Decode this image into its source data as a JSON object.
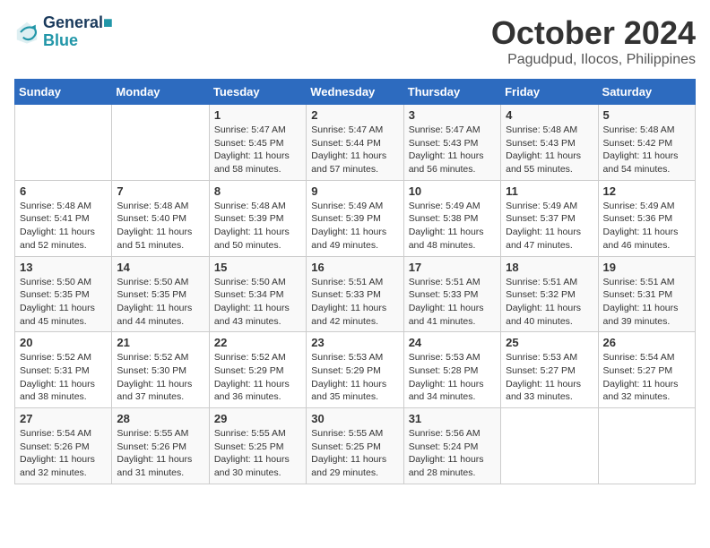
{
  "logo": {
    "line1": "General",
    "line2": "Blue"
  },
  "title": "October 2024",
  "subtitle": "Pagudpud, Ilocos, Philippines",
  "weekdays": [
    "Sunday",
    "Monday",
    "Tuesday",
    "Wednesday",
    "Thursday",
    "Friday",
    "Saturday"
  ],
  "weeks": [
    [
      {
        "day": "",
        "sunrise": "",
        "sunset": "",
        "daylight": ""
      },
      {
        "day": "",
        "sunrise": "",
        "sunset": "",
        "daylight": ""
      },
      {
        "day": "1",
        "sunrise": "Sunrise: 5:47 AM",
        "sunset": "Sunset: 5:45 PM",
        "daylight": "Daylight: 11 hours and 58 minutes."
      },
      {
        "day": "2",
        "sunrise": "Sunrise: 5:47 AM",
        "sunset": "Sunset: 5:44 PM",
        "daylight": "Daylight: 11 hours and 57 minutes."
      },
      {
        "day": "3",
        "sunrise": "Sunrise: 5:47 AM",
        "sunset": "Sunset: 5:43 PM",
        "daylight": "Daylight: 11 hours and 56 minutes."
      },
      {
        "day": "4",
        "sunrise": "Sunrise: 5:48 AM",
        "sunset": "Sunset: 5:43 PM",
        "daylight": "Daylight: 11 hours and 55 minutes."
      },
      {
        "day": "5",
        "sunrise": "Sunrise: 5:48 AM",
        "sunset": "Sunset: 5:42 PM",
        "daylight": "Daylight: 11 hours and 54 minutes."
      }
    ],
    [
      {
        "day": "6",
        "sunrise": "Sunrise: 5:48 AM",
        "sunset": "Sunset: 5:41 PM",
        "daylight": "Daylight: 11 hours and 52 minutes."
      },
      {
        "day": "7",
        "sunrise": "Sunrise: 5:48 AM",
        "sunset": "Sunset: 5:40 PM",
        "daylight": "Daylight: 11 hours and 51 minutes."
      },
      {
        "day": "8",
        "sunrise": "Sunrise: 5:48 AM",
        "sunset": "Sunset: 5:39 PM",
        "daylight": "Daylight: 11 hours and 50 minutes."
      },
      {
        "day": "9",
        "sunrise": "Sunrise: 5:49 AM",
        "sunset": "Sunset: 5:39 PM",
        "daylight": "Daylight: 11 hours and 49 minutes."
      },
      {
        "day": "10",
        "sunrise": "Sunrise: 5:49 AM",
        "sunset": "Sunset: 5:38 PM",
        "daylight": "Daylight: 11 hours and 48 minutes."
      },
      {
        "day": "11",
        "sunrise": "Sunrise: 5:49 AM",
        "sunset": "Sunset: 5:37 PM",
        "daylight": "Daylight: 11 hours and 47 minutes."
      },
      {
        "day": "12",
        "sunrise": "Sunrise: 5:49 AM",
        "sunset": "Sunset: 5:36 PM",
        "daylight": "Daylight: 11 hours and 46 minutes."
      }
    ],
    [
      {
        "day": "13",
        "sunrise": "Sunrise: 5:50 AM",
        "sunset": "Sunset: 5:35 PM",
        "daylight": "Daylight: 11 hours and 45 minutes."
      },
      {
        "day": "14",
        "sunrise": "Sunrise: 5:50 AM",
        "sunset": "Sunset: 5:35 PM",
        "daylight": "Daylight: 11 hours and 44 minutes."
      },
      {
        "day": "15",
        "sunrise": "Sunrise: 5:50 AM",
        "sunset": "Sunset: 5:34 PM",
        "daylight": "Daylight: 11 hours and 43 minutes."
      },
      {
        "day": "16",
        "sunrise": "Sunrise: 5:51 AM",
        "sunset": "Sunset: 5:33 PM",
        "daylight": "Daylight: 11 hours and 42 minutes."
      },
      {
        "day": "17",
        "sunrise": "Sunrise: 5:51 AM",
        "sunset": "Sunset: 5:33 PM",
        "daylight": "Daylight: 11 hours and 41 minutes."
      },
      {
        "day": "18",
        "sunrise": "Sunrise: 5:51 AM",
        "sunset": "Sunset: 5:32 PM",
        "daylight": "Daylight: 11 hours and 40 minutes."
      },
      {
        "day": "19",
        "sunrise": "Sunrise: 5:51 AM",
        "sunset": "Sunset: 5:31 PM",
        "daylight": "Daylight: 11 hours and 39 minutes."
      }
    ],
    [
      {
        "day": "20",
        "sunrise": "Sunrise: 5:52 AM",
        "sunset": "Sunset: 5:31 PM",
        "daylight": "Daylight: 11 hours and 38 minutes."
      },
      {
        "day": "21",
        "sunrise": "Sunrise: 5:52 AM",
        "sunset": "Sunset: 5:30 PM",
        "daylight": "Daylight: 11 hours and 37 minutes."
      },
      {
        "day": "22",
        "sunrise": "Sunrise: 5:52 AM",
        "sunset": "Sunset: 5:29 PM",
        "daylight": "Daylight: 11 hours and 36 minutes."
      },
      {
        "day": "23",
        "sunrise": "Sunrise: 5:53 AM",
        "sunset": "Sunset: 5:29 PM",
        "daylight": "Daylight: 11 hours and 35 minutes."
      },
      {
        "day": "24",
        "sunrise": "Sunrise: 5:53 AM",
        "sunset": "Sunset: 5:28 PM",
        "daylight": "Daylight: 11 hours and 34 minutes."
      },
      {
        "day": "25",
        "sunrise": "Sunrise: 5:53 AM",
        "sunset": "Sunset: 5:27 PM",
        "daylight": "Daylight: 11 hours and 33 minutes."
      },
      {
        "day": "26",
        "sunrise": "Sunrise: 5:54 AM",
        "sunset": "Sunset: 5:27 PM",
        "daylight": "Daylight: 11 hours and 32 minutes."
      }
    ],
    [
      {
        "day": "27",
        "sunrise": "Sunrise: 5:54 AM",
        "sunset": "Sunset: 5:26 PM",
        "daylight": "Daylight: 11 hours and 32 minutes."
      },
      {
        "day": "28",
        "sunrise": "Sunrise: 5:55 AM",
        "sunset": "Sunset: 5:26 PM",
        "daylight": "Daylight: 11 hours and 31 minutes."
      },
      {
        "day": "29",
        "sunrise": "Sunrise: 5:55 AM",
        "sunset": "Sunset: 5:25 PM",
        "daylight": "Daylight: 11 hours and 30 minutes."
      },
      {
        "day": "30",
        "sunrise": "Sunrise: 5:55 AM",
        "sunset": "Sunset: 5:25 PM",
        "daylight": "Daylight: 11 hours and 29 minutes."
      },
      {
        "day": "31",
        "sunrise": "Sunrise: 5:56 AM",
        "sunset": "Sunset: 5:24 PM",
        "daylight": "Daylight: 11 hours and 28 minutes."
      },
      {
        "day": "",
        "sunrise": "",
        "sunset": "",
        "daylight": ""
      },
      {
        "day": "",
        "sunrise": "",
        "sunset": "",
        "daylight": ""
      }
    ]
  ]
}
